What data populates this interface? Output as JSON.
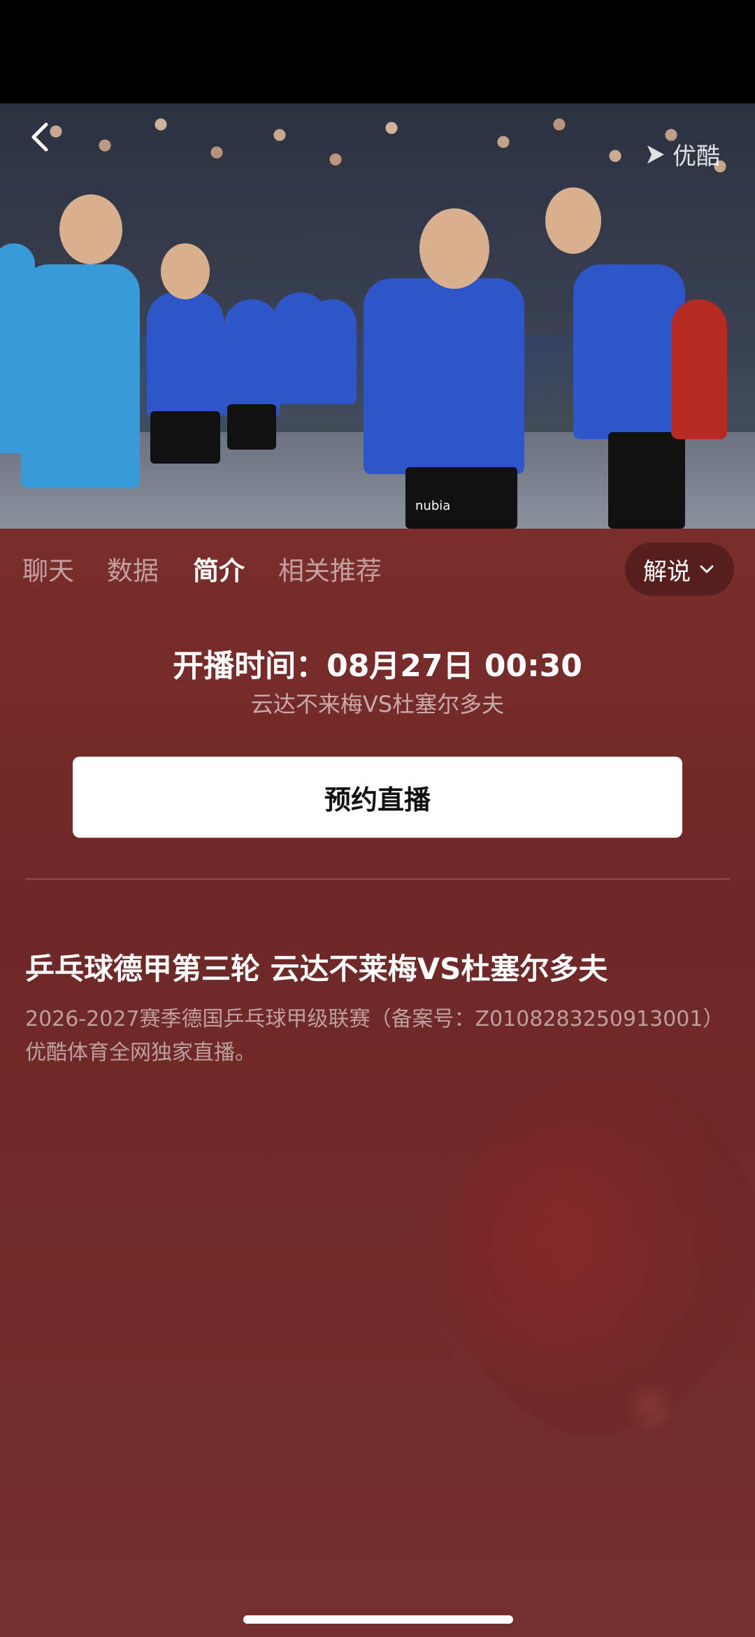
{
  "video": {
    "logo_text": "优酷",
    "back_icon": "chevron-left-icon",
    "jersey_text": "nubia"
  },
  "tabs": [
    {
      "label": "聊天",
      "active": false
    },
    {
      "label": "数据",
      "active": false
    },
    {
      "label": "简介",
      "active": true
    },
    {
      "label": "相关推荐",
      "active": false
    }
  ],
  "commentary": {
    "label": "解说"
  },
  "schedule": {
    "start_time": "开播时间：08月27日 00:30",
    "match": "云达不来梅VS杜塞尔多夫"
  },
  "reserve_button": {
    "label": "预约直播"
  },
  "intro": {
    "title": "乒乓球德甲第三轮 云达不莱梅VS杜塞尔多夫",
    "description": "2026-2027赛季德国乒乓球甲级联赛（备案号：Z0108283250913001）优酷体育全网独家直播。"
  },
  "colors": {
    "panel_bg": "#7a2e2c",
    "accent_white": "#ffffff"
  }
}
